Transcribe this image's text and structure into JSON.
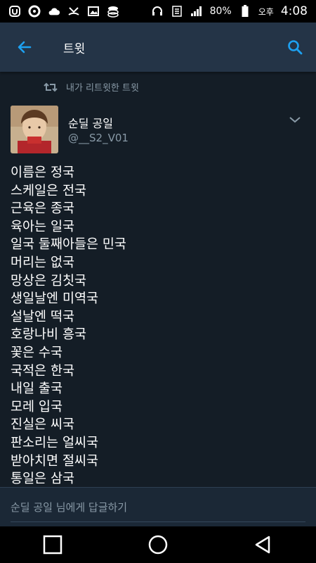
{
  "status_bar": {
    "battery_text": "80%",
    "time": "4:08",
    "ampm": "오후",
    "left_icons": [
      "u-plus-icon",
      "k-circle-icon",
      "cloud-icon",
      "missed-call-icon",
      "gallery-icon",
      "layers-icon"
    ],
    "right_icons": [
      "headset-icon",
      "volte-icon",
      "signal-icon",
      "battery-icon"
    ]
  },
  "app_bar": {
    "title": "트윗",
    "accent_color": "#1da1f2"
  },
  "retweet_context": {
    "text": "내가 리트윗한 트윗"
  },
  "tweet": {
    "author_name": "순딜 공일",
    "author_handle": "@__S2_V01",
    "lines": [
      "이름은 정국",
      "스케일은 전국",
      "근육은 종국",
      "육아는 일국",
      "일국 둘째아들은 민국",
      "머리는 없국",
      "망상은 김칫국",
      "생일날엔 미역국",
      "설날엔 떡국",
      "호랑나비 흥국",
      "꽃은 수국",
      "국적은 한국",
      "내일 출국",
      "모레 입국",
      "진실은 씨국",
      "판소리는 얼씨국",
      "받아치면 절씨국",
      "통일은 삼국"
    ]
  },
  "reply": {
    "placeholder": "순딜 공일 님에게 답글하기"
  },
  "nav_bar": {
    "buttons": [
      "recents-button",
      "home-button",
      "back-button"
    ]
  }
}
